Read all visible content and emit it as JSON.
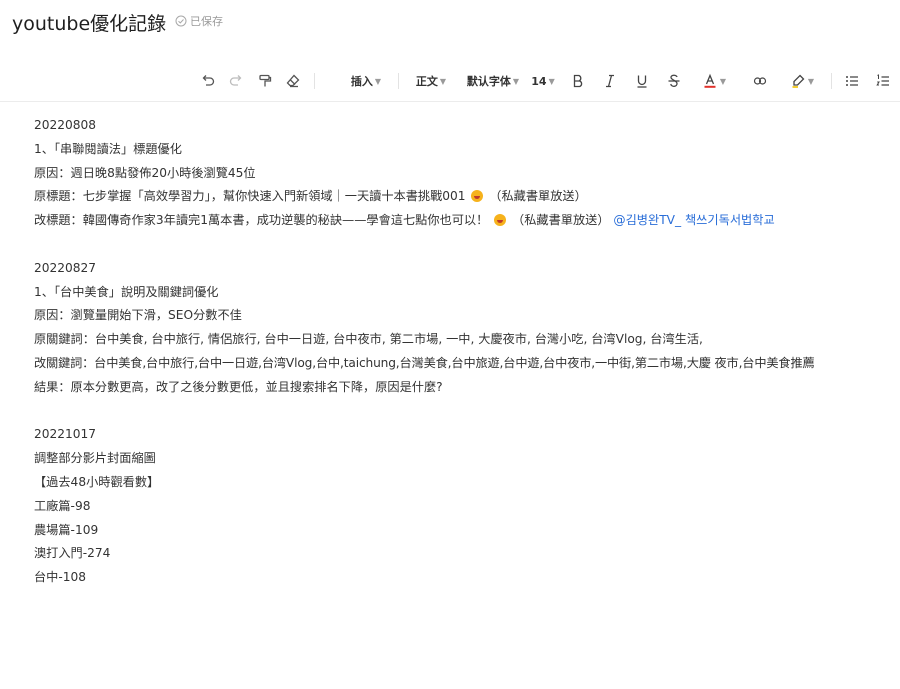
{
  "document": {
    "title": "youtube優化記錄",
    "saved_status": "已保存"
  },
  "toolbar": {
    "insert_label": "插入",
    "style_label": "正文",
    "font_label": "默认字体",
    "font_size": "14",
    "icons": [
      "undo-icon",
      "redo-icon",
      "format-painter-icon",
      "clear-format-icon",
      "bold-icon",
      "italic-icon",
      "underline-icon",
      "strikethrough-icon",
      "font-color-icon",
      "link-icon",
      "highlight-icon",
      "bullet-list-icon",
      "numbered-list-icon"
    ],
    "font_color_accent": "#e0312b"
  },
  "content": {
    "s1": {
      "date": "20220808",
      "heading": "1、「串聯閱讀法」標題優化",
      "reason": "原因：週日晚8點發佈20小時後瀏覽45位",
      "orig_title": "原標題：七步掌握「高效學習力」，幫你快速入門新領域｜一天讀十本書挑戰001",
      "orig_title_tail": "（私藏書單放送）",
      "new_title": "改標題：韓國傳奇作家3年讀完1萬本書，成功逆襲的秘訣——學會這七點你也可以！",
      "new_title_tail": "（私藏書單放送）",
      "mention": "@김병완TV_ 책쓰기독서법학교"
    },
    "s2": {
      "date": "20220827",
      "heading": "1、「台中美食」說明及關鍵詞優化",
      "reason": "原因：瀏覽量開始下滑，SEO分數不佳",
      "orig_keywords": "原關鍵詞：台中美食, 台中旅行, 情侶旅行, 台中一日遊, 台中夜市, 第二市場, 一中, 大慶夜市, 台灣小吃, 台湾Vlog, 台湾生活,",
      "new_keywords": "改關鍵詞：台中美食,台中旅行,台中一日遊,台湾Vlog,台中,taichung,台灣美食,台中旅遊,台中遊,台中夜市,一中街,第二市場,大慶 夜市,台中美食推薦",
      "result": "結果：原本分數更高，改了之後分數更低，並且搜索排名下降，原因是什麼?"
    },
    "s3": {
      "date": "20221017",
      "heading": "調整部分影片封面縮圖",
      "subheading": "【過去48小時觀看數】",
      "items": [
        "工廠篇-98",
        "農場篇-109",
        "澳打入門-274",
        "台中-108"
      ]
    }
  }
}
